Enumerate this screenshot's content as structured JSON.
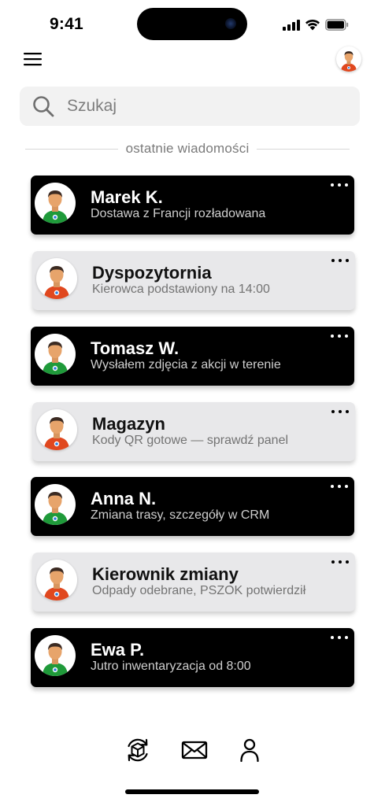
{
  "status_bar": {
    "time": "9:41"
  },
  "search": {
    "placeholder": "Szukaj",
    "value": ""
  },
  "section": {
    "label": "ostatnie wiadomości"
  },
  "conversations": [
    {
      "name": "Marek K.",
      "preview": "Dostawa z Francji rozładowana",
      "style": "dark",
      "avatar_shirt": "#1f9a3a"
    },
    {
      "name": "Dyspozytornia",
      "preview": "Kierowca podstawiony na 14:00",
      "style": "light",
      "avatar_shirt": "#e0481f"
    },
    {
      "name": "Tomasz W.",
      "preview": "Wysłałem zdjęcia z akcji w terenie",
      "style": "dark",
      "avatar_shirt": "#1f9a3a"
    },
    {
      "name": "Magazyn",
      "preview": "Kody QR gotowe — sprawdź panel",
      "style": "light",
      "avatar_shirt": "#e0481f"
    },
    {
      "name": "Anna N.",
      "preview": "Zmiana trasy, szczegóły w CRM",
      "style": "dark",
      "avatar_shirt": "#1f9a3a"
    },
    {
      "name": "Kierownik zmiany",
      "preview": "Odpady odebrane, PSZOK potwierdził",
      "style": "light",
      "avatar_shirt": "#e0481f"
    },
    {
      "name": "Ewa P.",
      "preview": "Jutro inwentaryzacja od 8:00",
      "style": "dark",
      "avatar_shirt": "#1f9a3a"
    }
  ],
  "header": {
    "menu_icon": "hamburger-menu-icon",
    "avatar_shirt": "#e0481f"
  },
  "bottom_nav": [
    {
      "icon": "package-sync-icon"
    },
    {
      "icon": "envelope-icon"
    },
    {
      "icon": "user-icon"
    }
  ],
  "colors": {
    "dark_card": "#000000",
    "light_card": "#e8e8ea",
    "avatar_skin": "#e7a46b",
    "avatar_hair": "#3b2a22",
    "green_shirt": "#1f9a3a",
    "orange_shirt": "#e0481f",
    "badge_blue": "#2b7de0"
  }
}
